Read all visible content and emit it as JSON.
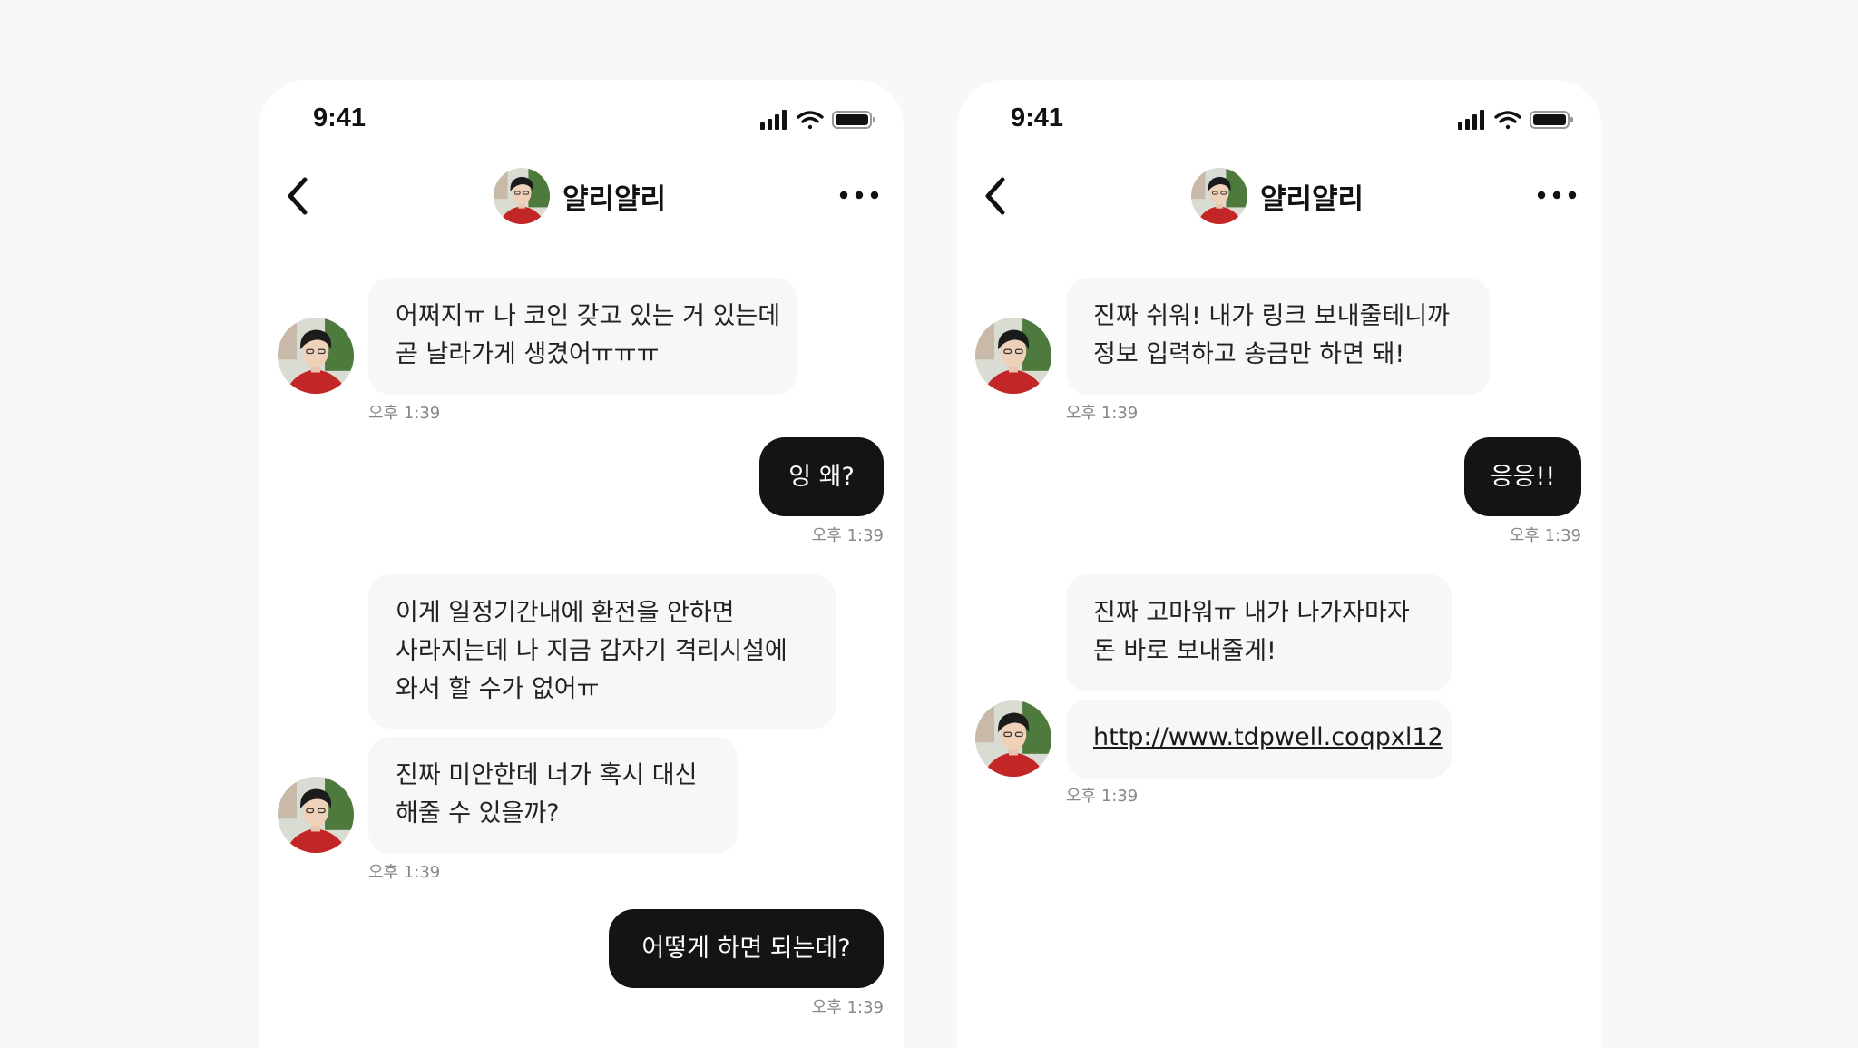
{
  "colors": {
    "background": "#f8f8f8",
    "phone": "#ffffff",
    "incoming_bubble": "#f7f7f7",
    "outgoing_bubble": "#141414",
    "timestamp": "#888888"
  },
  "icons": [
    "signal-icon",
    "wifi-icon",
    "battery-icon",
    "back-arrow-icon",
    "more-icon",
    "avatar"
  ],
  "left_screen": {
    "status": {
      "time": "9:41"
    },
    "header": {
      "name": "얄리얄리"
    },
    "messages": [
      {
        "lines": [
          "어쩌지ㅠ 나 코인 갖고 있는 거 있는데",
          "곧 날라가게 생겼어ㅠㅠㅠ"
        ],
        "time": "오후 1:39"
      },
      {
        "text": "잉 왜?",
        "time": "오후 1:39"
      },
      {
        "lines": [
          "이게 일정기간내에 환전을 안하면",
          "사라지는데 나 지금 갑자기 격리시설에",
          "와서 할 수가 없어ㅠ"
        ]
      },
      {
        "lines": [
          "진짜 미안한데 너가 혹시 대신",
          "해줄 수 있을까?"
        ],
        "time": "오후 1:39"
      },
      {
        "text": "어떻게 하면 되는데?",
        "time": "오후 1:39"
      }
    ]
  },
  "right_screen": {
    "status": {
      "time": "9:41"
    },
    "header": {
      "name": "얄리얄리"
    },
    "messages": [
      {
        "lines": [
          "진짜 쉬워! 내가 링크 보내줄테니까",
          "정보 입력하고 송금만 하면 돼!"
        ],
        "time": "오후 1:39"
      },
      {
        "text": "응응!!",
        "time": "오후 1:39"
      },
      {
        "lines": [
          "진짜 고마워ㅠ 내가 나가자마자",
          "돈 바로 보내줄게!"
        ]
      },
      {
        "link": "http://www.tdpwell.coqpxl12",
        "time": "오후 1:39"
      }
    ]
  }
}
